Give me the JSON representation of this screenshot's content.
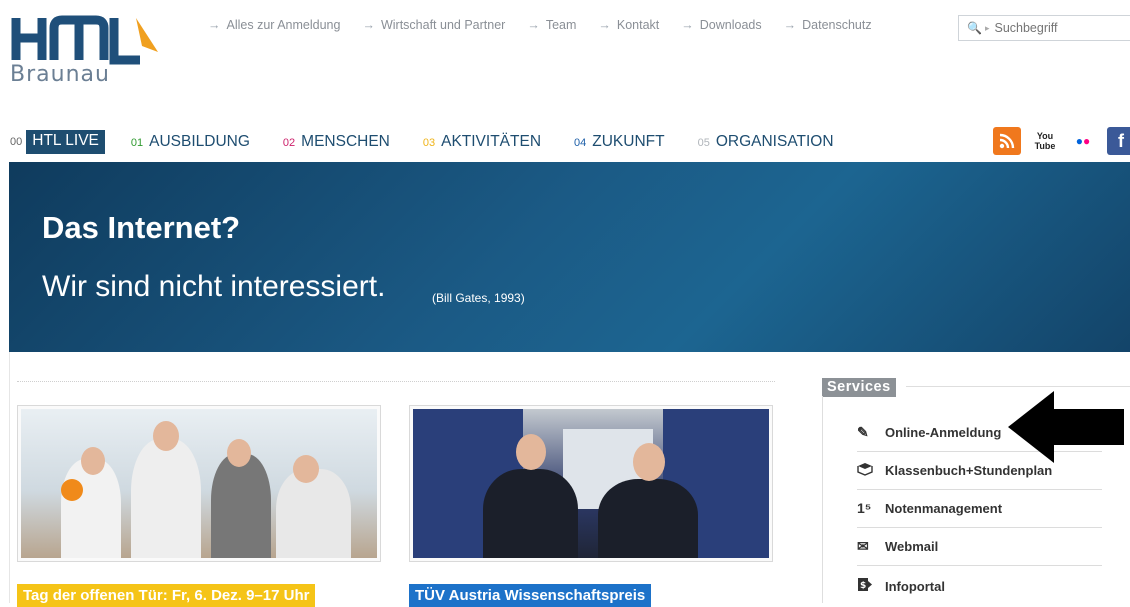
{
  "logo": {
    "text": "Braunau"
  },
  "top_links": [
    "Alles zur Anmeldung",
    "Wirtschaft und Partner",
    "Team",
    "Kontakt",
    "Downloads",
    "Datenschutz"
  ],
  "search": {
    "placeholder": "Suchbegriff"
  },
  "main_nav": [
    {
      "num": "00",
      "label": "HTL LIVE",
      "color": "#1e4d70",
      "num_color": "#666666"
    },
    {
      "num": "01",
      "label": "AUSBILDUNG",
      "color": "#1e4d70",
      "num_color": "#2f9a2f"
    },
    {
      "num": "02",
      "label": "MENSCHEN",
      "color": "#1e4d70",
      "num_color": "#cc1f6a"
    },
    {
      "num": "03",
      "label": "AKTIVITÄTEN",
      "color": "#1e4d70",
      "num_color": "#f0b418"
    },
    {
      "num": "04",
      "label": "ZUKUNFT",
      "color": "#1e4d70",
      "num_color": "#1d5fa8"
    },
    {
      "num": "05",
      "label": "ORGANISATION",
      "color": "#1e4d70",
      "num_color": "#b0b5ba"
    }
  ],
  "social": [
    {
      "icon": "rss-icon",
      "bg": "#f0781d",
      "text": ""
    },
    {
      "icon": "youtube-icon",
      "bg": "#a61c1c",
      "text": "You Tube"
    },
    {
      "icon": "flickr-icon",
      "bg": "#ffffff",
      "text": "●●"
    },
    {
      "icon": "facebook-icon",
      "bg": "#3b5998",
      "text": "f"
    }
  ],
  "hero": {
    "title": "Das Internet?",
    "subtitle": "Wir sind nicht interessiert.",
    "source": "(Bill Gates, 1993)"
  },
  "news": [
    {
      "caption": "Tag der offenen Tür: Fr, 6. Dez. 9–17 Uhr"
    },
    {
      "caption": "TÜV Austria Wissenschaftspreis"
    }
  ],
  "services": {
    "heading": "Services",
    "items": [
      {
        "icon": "pencil-icon",
        "glyph": "✎",
        "label": "Online-Anmeldung"
      },
      {
        "icon": "book-icon",
        "glyph": "📖",
        "label": "Klassenbuch+Stundenplan"
      },
      {
        "icon": "grade-icon",
        "glyph": "1⁵",
        "label": "Notenmanagement"
      },
      {
        "icon": "mail-icon",
        "glyph": "✉",
        "label": "Webmail"
      },
      {
        "icon": "info-icon",
        "glyph": "ℹ",
        "label": "Infoportal"
      }
    ]
  },
  "colors": {
    "hero": "#1b5a85",
    "accent_yellow": "#f5c417",
    "accent_blue": "#1d72c9"
  }
}
